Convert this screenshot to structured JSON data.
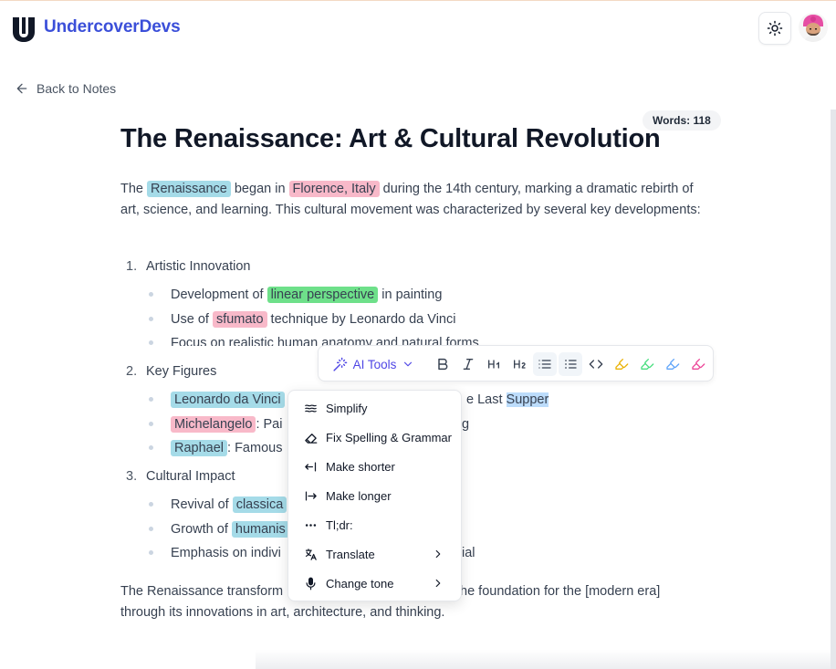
{
  "header": {
    "brand": "UndercoverDevs",
    "theme_icon": "sun-icon",
    "avatar_icon": "user-avatar"
  },
  "nav": {
    "back_label": "Back to Notes"
  },
  "editor": {
    "word_count": "Words: 118",
    "title": "The Renaissance: Art & Cultural Revolution",
    "intro": {
      "t1": "The ",
      "h1": "Renaissance",
      "t2": " began in ",
      "h2": "Florence, Italy",
      "t3": " during the 14th century, marking a dramatic rebirth of art, science, and learning. This cultural movement was characterized by several key developments:"
    },
    "list": [
      {
        "num": "1.",
        "label": "Artistic Innovation",
        "items": [
          {
            "pre": "Development of ",
            "hl": "linear perspective",
            "post": " in painting"
          },
          {
            "pre": "Use of ",
            "hl": "sfumato",
            "post": " technique by Leonardo da Vinci"
          },
          {
            "text": "Focus on realistic human anatomy and natural forms"
          }
        ]
      },
      {
        "num": "2.",
        "label": "Key Figures",
        "items": [
          {
            "hl": "Leonardo da Vinci",
            "post": "",
            "tail_pre": "e Last ",
            "tail_sel": "Supper"
          },
          {
            "hl": "Michelangelo",
            "post": ": Pai",
            "tail": "g"
          },
          {
            "hl": "Raphael",
            "post": ": Famous"
          }
        ]
      },
      {
        "num": "3.",
        "label": "Cultural Impact",
        "items": [
          {
            "pre": "Revival of ",
            "hl": "classica"
          },
          {
            "pre": "Growth of ",
            "hl": "humanis"
          },
          {
            "pre": "Emphasis on indivi",
            "tail": "ial"
          }
        ]
      }
    ],
    "closing": {
      "l1a": "The Renaissance transform",
      "l1b": "the foundation for the [modern era]",
      "l2": "through its innovations in art, architecture, and thinking."
    }
  },
  "toolbar": {
    "ai_label": "AI Tools",
    "buttons": [
      "bold-icon",
      "italic-icon",
      "heading-1-icon",
      "heading-2-icon",
      "bullet-list-icon",
      "ordered-list-icon",
      "code-icon",
      "highlighter-yellow-icon",
      "highlighter-green-icon",
      "highlighter-blue-icon",
      "highlighter-pink-icon"
    ],
    "colors": {
      "yellow": "#eab308",
      "green": "#4ade80",
      "blue": "#60a5fa",
      "pink": "#ec4899",
      "accent": "#4f46e5"
    }
  },
  "ai_menu": {
    "items": [
      {
        "label": "Simplify",
        "icon": "waves-icon"
      },
      {
        "label": "Fix Spelling & Grammar",
        "icon": "eraser-icon"
      },
      {
        "label": "Make shorter",
        "icon": "arrow-left-to-line-icon"
      },
      {
        "label": "Make longer",
        "icon": "arrow-right-from-line-icon"
      },
      {
        "label": "Tl;dr:",
        "icon": "ellipsis-icon"
      },
      {
        "label": "Translate",
        "icon": "languages-icon"
      },
      {
        "label": "Change tone",
        "icon": "mic-icon"
      }
    ]
  }
}
